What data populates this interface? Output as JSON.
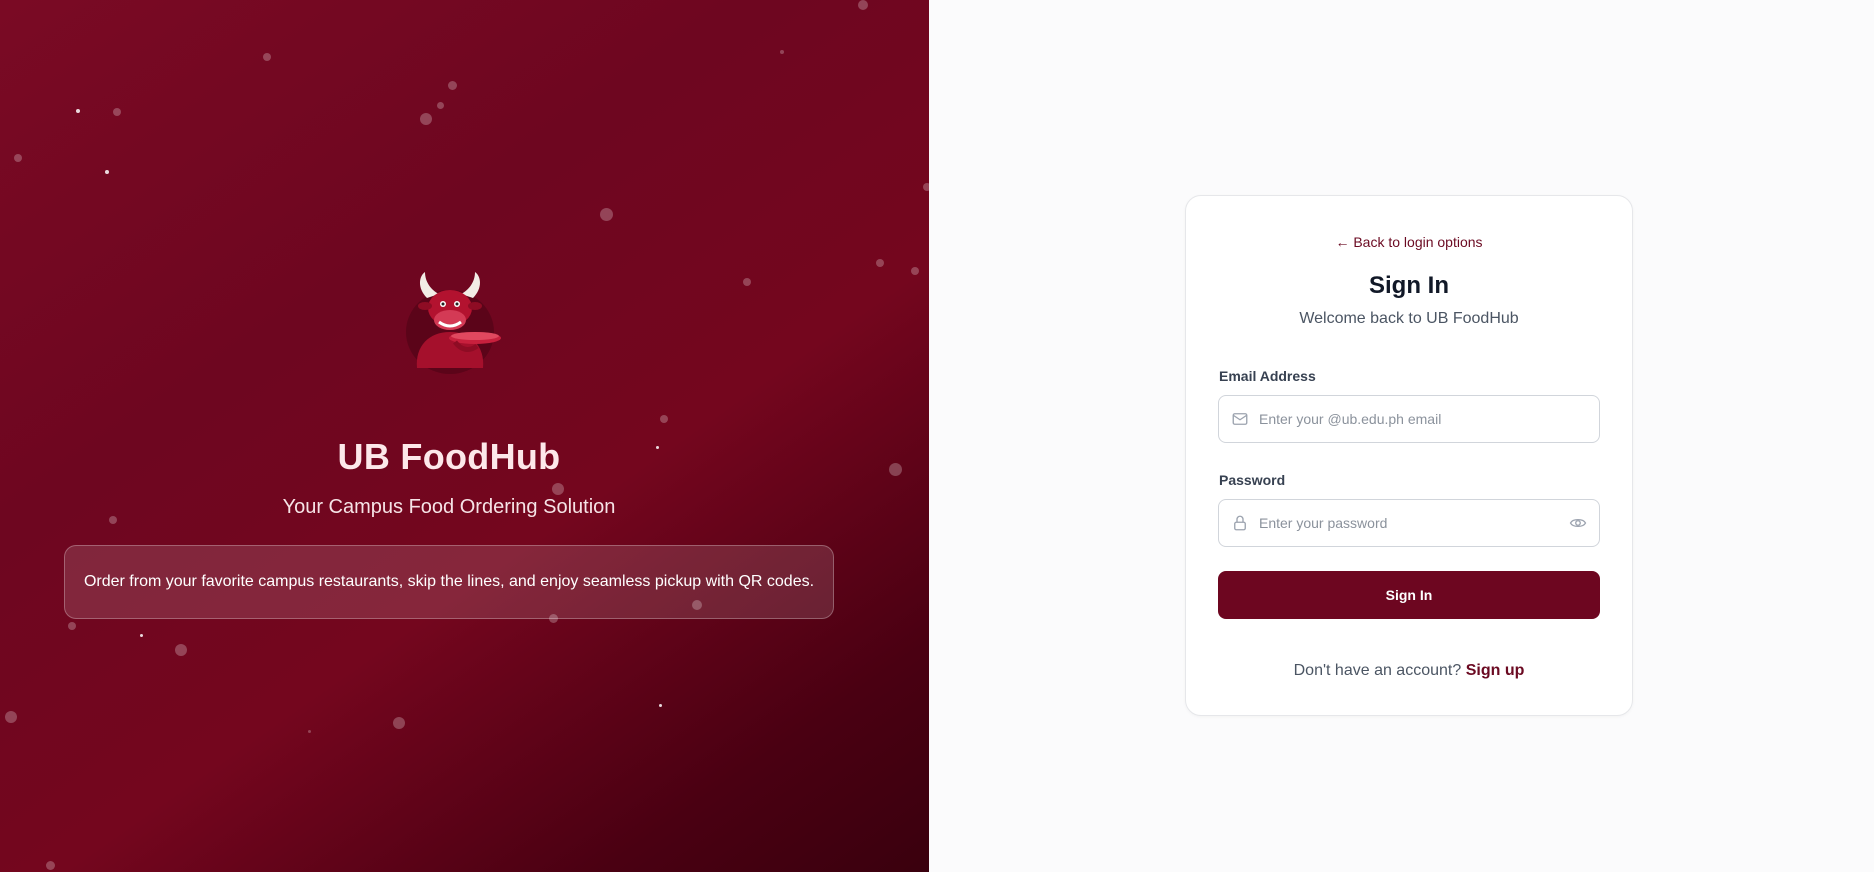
{
  "brand": {
    "title": "UB FoodHub",
    "subtitle": "Your Campus Food Ordering Solution",
    "description": "Order from your favorite campus restaurants, skip the lines, and enjoy seamless pickup with QR codes.",
    "logo_icon": "bull-mascot-icon"
  },
  "login": {
    "back_link": "← Back to login options",
    "title": "Sign In",
    "subtitle": "Welcome back to UB FoodHub",
    "email": {
      "label": "Email Address",
      "placeholder": "Enter your @ub.edu.ph email",
      "icon": "mail-icon"
    },
    "password": {
      "label": "Password",
      "placeholder": "Enter your password",
      "icon": "lock-icon",
      "toggle_icon": "eye-icon"
    },
    "submit_label": "Sign In",
    "signup_prompt": "Don't have an account?",
    "signup_link": "Sign up"
  },
  "colors": {
    "brand_primary": "#6d0620",
    "panel_gradient_dark": "#3a000e",
    "card_background": "#ffffff"
  }
}
